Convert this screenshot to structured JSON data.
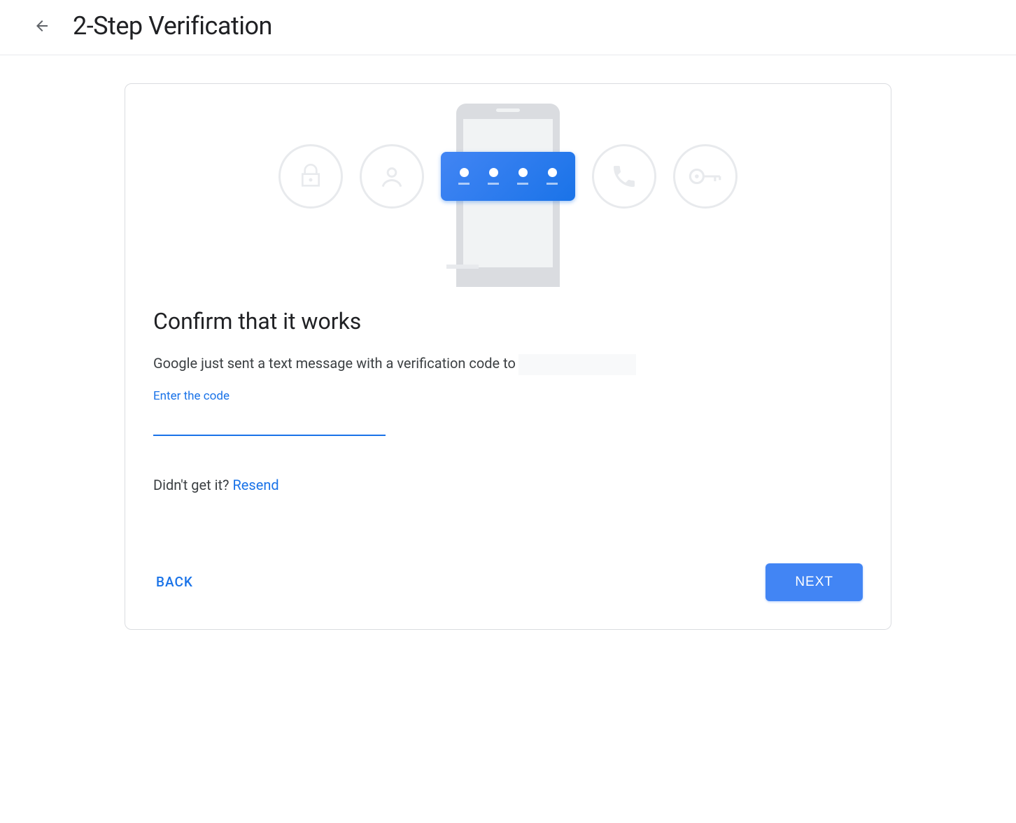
{
  "header": {
    "title": "2-Step Verification"
  },
  "card": {
    "heading": "Confirm that it works",
    "description": "Google just sent a text message with a verification code to",
    "field_label": "Enter the code",
    "code_value": "",
    "resend_prompt": "Didn't get it? ",
    "resend_link": "Resend",
    "back_label": "BACK",
    "next_label": "NEXT"
  }
}
